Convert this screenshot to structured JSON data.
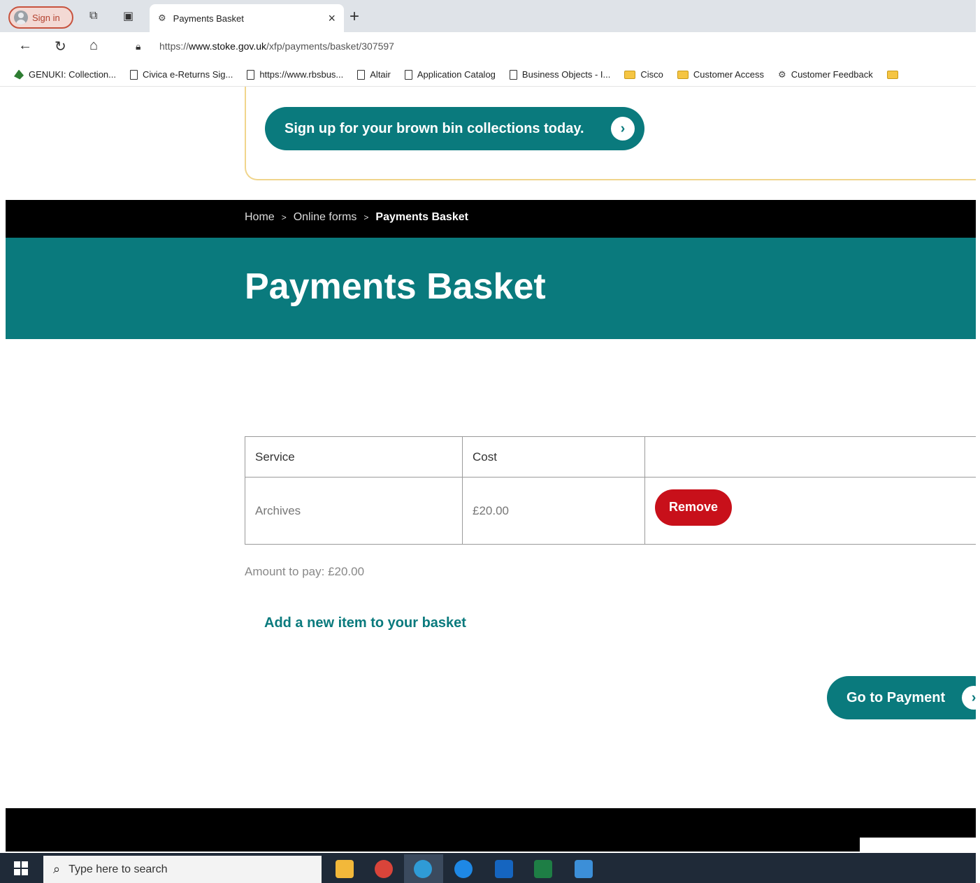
{
  "browser": {
    "signin_label": "Sign in",
    "tab_title": "Payments Basket",
    "url_prefix": "https://",
    "url_domain": "www.stoke.gov.uk",
    "url_path": "/xfp/payments/basket/307597",
    "favorites": [
      {
        "label": "GENUKI: Collection...",
        "icon": "leaf-icon"
      },
      {
        "label": "Civica e-Returns Sig...",
        "icon": "page-icon"
      },
      {
        "label": "https://www.rbsbus...",
        "icon": "page-icon"
      },
      {
        "label": "Altair",
        "icon": "page-icon"
      },
      {
        "label": "Application Catalog",
        "icon": "page-icon"
      },
      {
        "label": "Business Objects - I...",
        "icon": "page-icon"
      },
      {
        "label": "Cisco",
        "icon": "folder-icon"
      },
      {
        "label": "Customer Access",
        "icon": "folder-icon"
      },
      {
        "label": "Customer Feedback",
        "icon": "gear-icon"
      }
    ]
  },
  "promo": {
    "button_label": "Sign up for your brown bin collections today."
  },
  "breadcrumb": {
    "home": "Home",
    "online_forms": "Online forms",
    "current": "Payments Basket"
  },
  "page": {
    "title": "Payments Basket"
  },
  "basket": {
    "headers": {
      "service": "Service",
      "cost": "Cost",
      "action": ""
    },
    "rows": [
      {
        "service": "Archives",
        "cost": "£20.00",
        "action_label": "Remove"
      }
    ],
    "amount_to_pay": "Amount to pay: £20.00",
    "add_item_link": "Add a new item to your basket",
    "go_to_payment": "Go to Payment"
  },
  "taskbar": {
    "search_placeholder": "Type here to search",
    "apps": [
      "file-explorer-icon",
      "chrome-icon",
      "edge-icon",
      "skype-icon",
      "outlook-icon",
      "excel-icon",
      "app-icon"
    ]
  },
  "colors": {
    "brand_teal": "#0a7a7d",
    "remove_red": "#c8101a",
    "promo_border": "#f0d58c"
  }
}
